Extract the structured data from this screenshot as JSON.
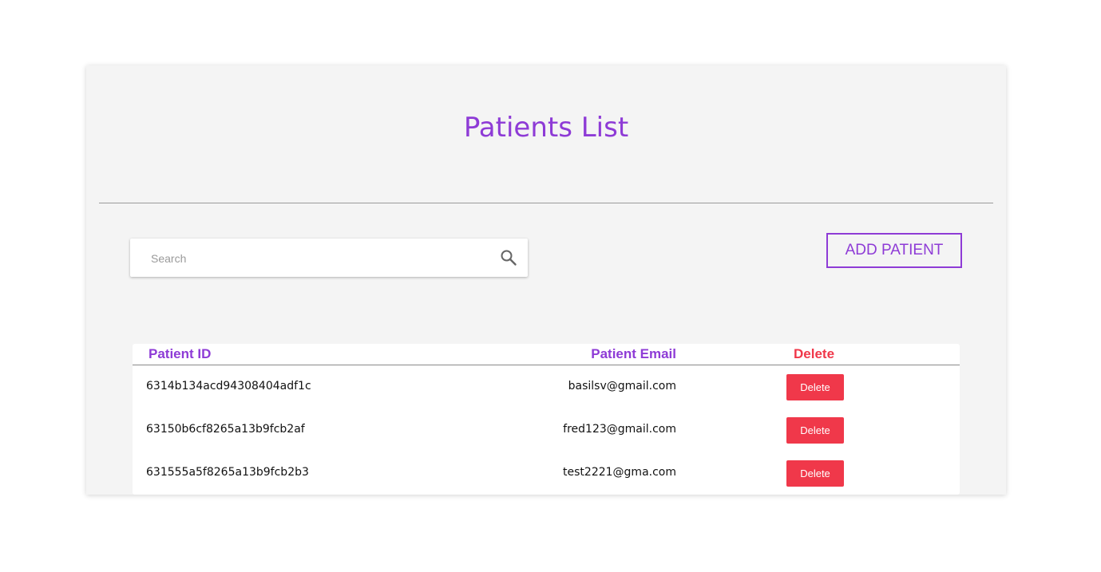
{
  "page": {
    "title": "Patients List"
  },
  "search": {
    "placeholder": "Search",
    "value": "",
    "icon": "search-icon"
  },
  "actions": {
    "add_patient_label": "ADD PATIENT"
  },
  "table": {
    "headers": {
      "id": "Patient ID",
      "email": "Patient Email",
      "delete": "Delete"
    },
    "rows": [
      {
        "id": "6314b134acd94308404adf1c",
        "email": "basilsv@gmail.com",
        "delete_label": "Delete"
      },
      {
        "id": "63150b6cf8265a13b9fcb2af",
        "email": "fred123@gmail.com",
        "delete_label": "Delete"
      },
      {
        "id": "631555a5f8265a13b9fcb2b3",
        "email": "test2221@gma.com",
        "delete_label": "Delete"
      }
    ]
  },
  "colors": {
    "accent": "#8e3bd6",
    "danger": "#f0384a",
    "card_background": "#f4f4f4"
  }
}
